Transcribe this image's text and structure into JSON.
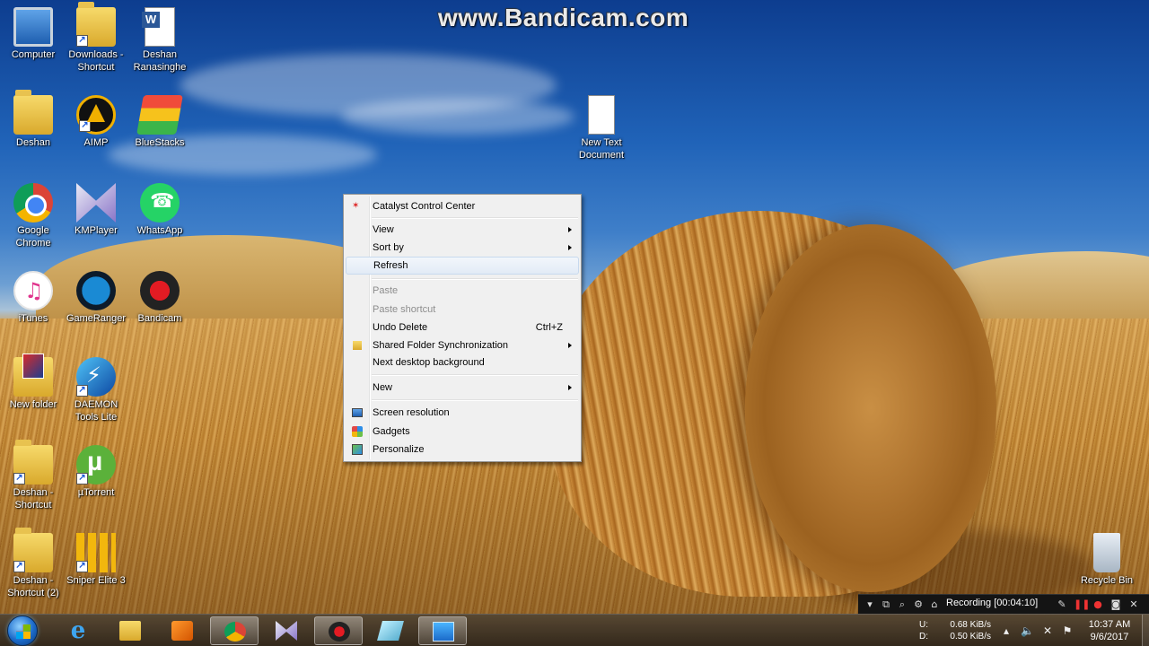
{
  "watermark": "www.Bandicam.com",
  "desktop_icons": [
    {
      "label": "Computer",
      "icon": "computer-icon"
    },
    {
      "label": "Downloads - Shortcut",
      "icon": "downloads-folder-icon"
    },
    {
      "label": "Deshan Ranasinghe",
      "icon": "word-document-icon"
    },
    {
      "label": "Deshan",
      "icon": "user-folder-icon"
    },
    {
      "label": "AIMP",
      "icon": "aimp-icon"
    },
    {
      "label": "BlueStacks",
      "icon": "bluestacks-icon"
    },
    {
      "label": "Google Chrome",
      "icon": "chrome-icon"
    },
    {
      "label": "KMPlayer",
      "icon": "kmplayer-icon"
    },
    {
      "label": "WhatsApp",
      "icon": "whatsapp-icon"
    },
    {
      "label": "iTunes",
      "icon": "itunes-icon"
    },
    {
      "label": "GameRanger",
      "icon": "gameranger-icon"
    },
    {
      "label": "Bandicam",
      "icon": "bandicam-icon"
    },
    {
      "label": "New folder",
      "icon": "new-folder-icon"
    },
    {
      "label": "DAEMON Tools Lite",
      "icon": "daemon-tools-icon"
    },
    {
      "label": "Deshan - Shortcut",
      "icon": "folder-shortcut-icon"
    },
    {
      "label": "µTorrent",
      "icon": "utorrent-icon"
    },
    {
      "label": "Deshan - Shortcut (2)",
      "icon": "folder-shortcut-icon"
    },
    {
      "label": "Sniper Elite 3",
      "icon": "sniper-elite-icon"
    },
    {
      "label": "New Text Document",
      "icon": "text-document-icon"
    },
    {
      "label": "Recycle Bin",
      "icon": "recycle-bin-icon"
    }
  ],
  "context_menu": {
    "items": [
      {
        "label": "Catalyst Control Center",
        "icon": "catalyst-icon"
      },
      {
        "label": "View",
        "submenu": true
      },
      {
        "label": "Sort by",
        "submenu": true
      },
      {
        "label": "Refresh",
        "highlighted": true
      },
      {
        "label": "Paste",
        "disabled": true
      },
      {
        "label": "Paste shortcut",
        "disabled": true
      },
      {
        "label": "Undo Delete",
        "shortcut": "Ctrl+Z"
      },
      {
        "label": "Shared Folder Synchronization",
        "submenu": true,
        "icon": "sync-folder-icon"
      },
      {
        "label": "Next desktop background"
      },
      {
        "label": "New",
        "submenu": true
      },
      {
        "label": "Screen resolution",
        "icon": "screen-resolution-icon"
      },
      {
        "label": "Gadgets",
        "icon": "gadgets-icon"
      },
      {
        "label": "Personalize",
        "icon": "personalize-icon"
      }
    ]
  },
  "recording_bar": {
    "status": "Recording [00:04:10]"
  },
  "taskbar": {
    "pinned": [
      {
        "name": "internet-explorer",
        "icon": "ie-icon"
      },
      {
        "name": "windows-explorer",
        "icon": "folder-icon"
      },
      {
        "name": "media-player",
        "icon": "media-player-icon"
      },
      {
        "name": "google-chrome",
        "icon": "chrome-icon"
      },
      {
        "name": "kmplayer",
        "icon": "kmplayer-icon"
      },
      {
        "name": "bandicam",
        "icon": "bandicam-icon",
        "active": true
      },
      {
        "name": "app-tile",
        "icon": "tile-icon"
      },
      {
        "name": "control-panel",
        "icon": "control-panel-icon",
        "active": true
      }
    ],
    "network": {
      "up_label": "U:",
      "up_value": "0.68 KiB/s",
      "down_label": "D:",
      "down_value": "0.50 KiB/s"
    },
    "clock": {
      "time": "10:37 AM",
      "date": "9/6/2017"
    }
  }
}
